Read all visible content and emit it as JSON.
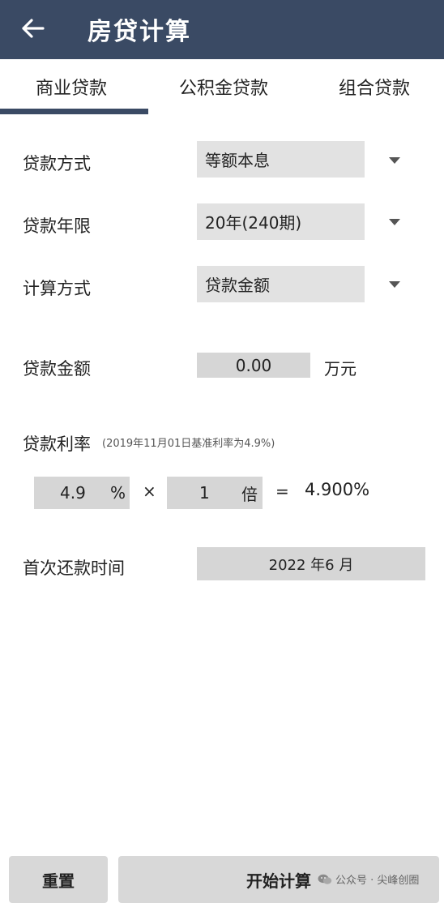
{
  "header": {
    "title": "房贷计算"
  },
  "tabs": [
    {
      "label": "商业贷款",
      "active": true
    },
    {
      "label": "公积金贷款",
      "active": false
    },
    {
      "label": "组合贷款",
      "active": false
    }
  ],
  "form": {
    "method": {
      "label": "贷款方式",
      "value": "等额本息"
    },
    "term": {
      "label": "贷款年限",
      "value": "20年(240期)"
    },
    "calc_mode": {
      "label": "计算方式",
      "value": "贷款金额"
    },
    "amount": {
      "label": "贷款金额",
      "value": "0.00",
      "unit": "万元"
    },
    "rate": {
      "label": "贷款利率",
      "note": "(2019年11月01日基准利率为4.9%)",
      "base_value": "4.9",
      "base_unit": "%",
      "times_symbol": "×",
      "multiplier": "1",
      "multiplier_unit": "倍",
      "equals_symbol": "=",
      "result": "4.900%"
    },
    "first_repay": {
      "label": "首次还款时间",
      "value": "2022 年6 月"
    }
  },
  "buttons": {
    "reset": "重置",
    "calculate": "开始计算"
  },
  "watermark": {
    "text": "公众号 · 尖峰创圈"
  },
  "colors": {
    "header_bg": "#3a4a64",
    "field_bg": "#e2e2e2",
    "button_bg": "#d8d8d8"
  }
}
